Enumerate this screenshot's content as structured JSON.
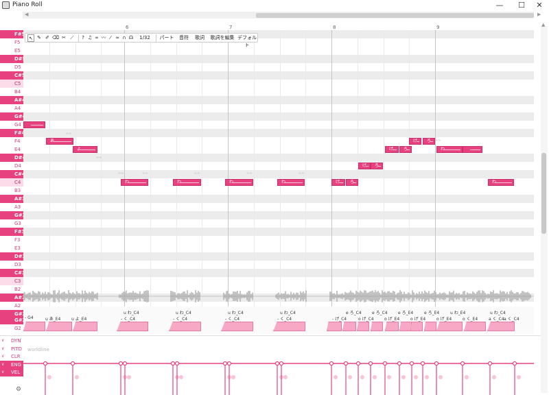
{
  "window": {
    "title": "Piano Roll",
    "minimize": "—",
    "maximize": "☐",
    "close": "✕"
  },
  "toolbar": {
    "tools": [
      "pointer-tool",
      "pen-tool",
      "pen-plus-tool",
      "eraser-tool",
      "knife-tool",
      "line-tool"
    ],
    "snap_value": "1/32",
    "menus": [
      "パート",
      "音符",
      "歌詞",
      "歌詞を編集",
      "デフォルト"
    ]
  },
  "measures": [
    "6",
    "7",
    "8",
    "9"
  ],
  "keys": [
    {
      "name": "F#5",
      "type": "black"
    },
    {
      "name": "F5",
      "type": "white"
    },
    {
      "name": "E5",
      "type": "white"
    },
    {
      "name": "D#5",
      "type": "black"
    },
    {
      "name": "D5",
      "type": "white"
    },
    {
      "name": "C#5",
      "type": "black"
    },
    {
      "name": "C5",
      "type": "c"
    },
    {
      "name": "B4",
      "type": "white"
    },
    {
      "name": "A#4",
      "type": "black"
    },
    {
      "name": "A4",
      "type": "white"
    },
    {
      "name": "G#4",
      "type": "black"
    },
    {
      "name": "G4",
      "type": "white"
    },
    {
      "name": "F#4",
      "type": "black"
    },
    {
      "name": "F4",
      "type": "white"
    },
    {
      "name": "E4",
      "type": "white"
    },
    {
      "name": "D#4",
      "type": "black"
    },
    {
      "name": "D4",
      "type": "white"
    },
    {
      "name": "C#4",
      "type": "black"
    },
    {
      "name": "C4",
      "type": "c"
    },
    {
      "name": "B3",
      "type": "white"
    },
    {
      "name": "A#3",
      "type": "black"
    },
    {
      "name": "A3",
      "type": "white"
    },
    {
      "name": "G#3",
      "type": "black"
    },
    {
      "name": "G3",
      "type": "white"
    },
    {
      "name": "F#3",
      "type": "black"
    },
    {
      "name": "F3",
      "type": "white"
    },
    {
      "name": "E3",
      "type": "white"
    },
    {
      "name": "D#3",
      "type": "black"
    },
    {
      "name": "D3",
      "type": "white"
    },
    {
      "name": "C#3",
      "type": "black"
    },
    {
      "name": "C3",
      "type": "c"
    },
    {
      "name": "B2",
      "type": "white"
    },
    {
      "name": "A#2",
      "type": "black"
    },
    {
      "name": "A2",
      "type": "white"
    },
    {
      "name": "G#2",
      "type": "black"
    },
    {
      "name": "G2",
      "type": "white"
    }
  ],
  "notes": [
    {
      "lyric": "",
      "pitch": "G4"
    },
    {
      "lyric": "あ",
      "pitch": "F4"
    },
    {
      "lyric": "よ",
      "pitch": "E4"
    },
    {
      "lyric": "わ",
      "pitch": "C4"
    },
    {
      "lyric": "わ",
      "pitch": "C4"
    },
    {
      "lyric": "わ",
      "pitch": "C4"
    },
    {
      "lyric": "わ",
      "pitch": "C4"
    },
    {
      "lyric": "げ",
      "pitch": "C4"
    },
    {
      "lyric": "ろ",
      "pitch": "C4"
    },
    {
      "lyric": "げ",
      "pitch": "D4"
    },
    {
      "lyric": "ろ",
      "pitch": "D4"
    },
    {
      "lyric": "げ",
      "pitch": "E4"
    },
    {
      "lyric": "ろ",
      "pitch": "E4"
    },
    {
      "lyric": "げ",
      "pitch": "F4"
    },
    {
      "lyric": "ろ",
      "pitch": "F4"
    },
    {
      "lyric": "わ",
      "pitch": "E4"
    },
    {
      "lyric": "",
      "pitch": "E4"
    },
    {
      "lyric": "",
      "pitch": "D4"
    },
    {
      "lyric": "わ",
      "pitch": "C4"
    }
  ],
  "vibrato_marks": [
    "≈≈",
    "≈≈",
    "≈≈",
    "≈≈",
    "≈≈",
    "≈≈",
    "≈≈",
    "≈≈",
    "≈≈"
  ],
  "phoneme_keys": [
    {
      "name": "G#2",
      "type": "black"
    },
    {
      "name": "G2",
      "type": "white"
    }
  ],
  "phonemes_top": [
    "u わ_C4",
    "u わ_C4",
    "u わ_C4",
    "u わ_C4",
    "e ろ_C4",
    "e ろ_C4",
    "e ろ_E4",
    "e ろ_E4",
    "u わ_E4",
    "u わ_C4"
  ],
  "phonemes_bottom": [
    "- G4",
    "u あ_E4",
    "u よ_E4",
    "- く_C4",
    "- く_C4",
    "- く_C4",
    "- く_C4",
    "- げ_C4",
    "o げ_C4",
    "o げ_E4",
    "o げ_E4",
    "o げ_E4",
    "o く_E4",
    "a く_C4",
    "a く_C4"
  ],
  "expressions": [
    {
      "name": "DYN",
      "selected": false
    },
    {
      "name": "PITD",
      "selected": false
    },
    {
      "name": "CLR",
      "selected": false
    },
    {
      "name": "ENG",
      "selected": true
    },
    {
      "name": "VEL",
      "selected": true
    }
  ],
  "expression_panel_label": "worldline",
  "colors": {
    "accent": "#e8417f",
    "grid_dark": "#ececec",
    "waveform": "#b5b5b5"
  }
}
